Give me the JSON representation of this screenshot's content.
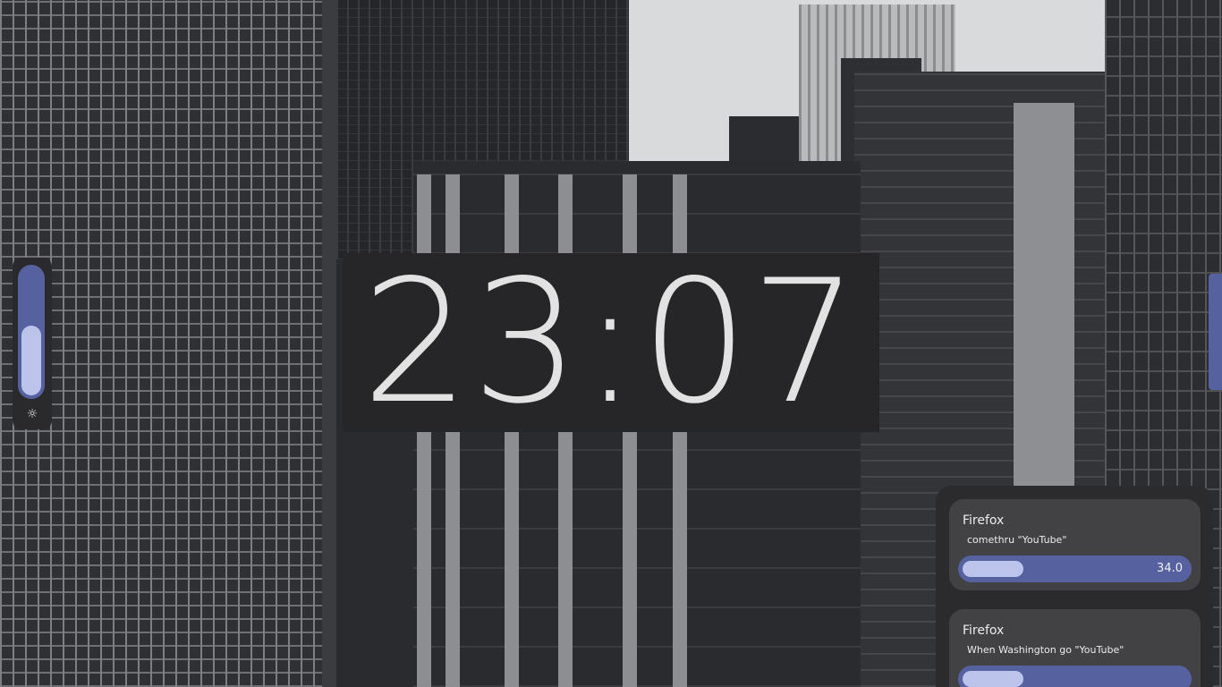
{
  "clock": {
    "time": "23:07"
  },
  "brightness": {
    "level": 0.55,
    "icon": "sun-icon",
    "glyph": "☼"
  },
  "colors": {
    "accent": "#5661a0",
    "accent_light": "#bcc4ec",
    "panel": "#2b2b2d",
    "card": "#424244"
  },
  "media": {
    "players": [
      {
        "app": "Firefox",
        "title": "comethru \"YouTube\"",
        "volume_label": "34.0",
        "volume": 0.34
      },
      {
        "app": "Firefox",
        "title": "When Washington go \"YouTube\"",
        "volume_label": "",
        "volume": 0.34
      }
    ]
  }
}
